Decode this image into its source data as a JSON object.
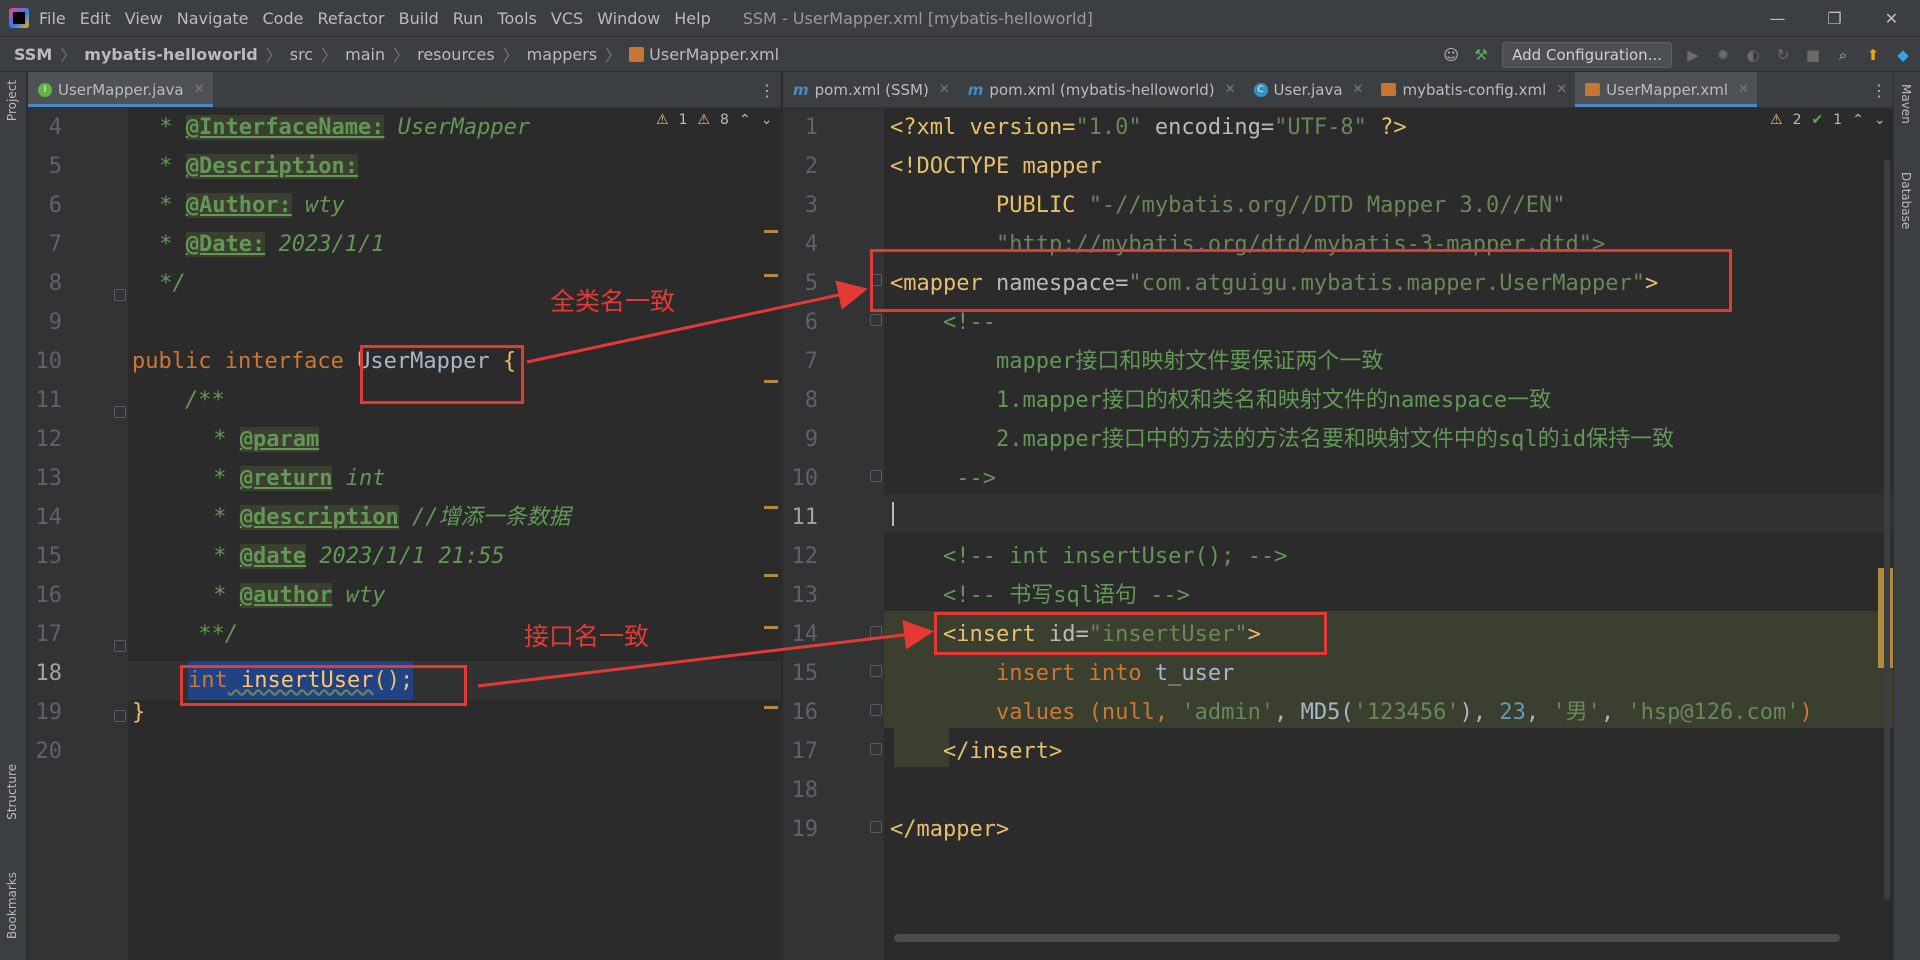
{
  "window": {
    "title": "SSM - UserMapper.xml [mybatis-helloworld]",
    "menu": [
      "File",
      "Edit",
      "View",
      "Navigate",
      "Code",
      "Refactor",
      "Build",
      "Run",
      "Tools",
      "VCS",
      "Window",
      "Help"
    ]
  },
  "breadcrumb": [
    "SSM",
    "mybatis-helloworld",
    "src",
    "main",
    "resources",
    "mappers",
    "UserMapper.xml"
  ],
  "toolbar": {
    "run_config_label": "Add Configuration..."
  },
  "side_left": {
    "project": "Project",
    "structure": "Structure",
    "bookmarks": "Bookmarks"
  },
  "side_right": {
    "maven": "Maven",
    "database": "Database"
  },
  "left_tabs": [
    {
      "label": "UserMapper.java"
    }
  ],
  "right_tabs": [
    {
      "label": "pom.xml (SSM)"
    },
    {
      "label": "pom.xml (mybatis-helloworld)"
    },
    {
      "label": "User.java"
    },
    {
      "label": "mybatis-config.xml"
    },
    {
      "label": "UserMapper.xml"
    }
  ],
  "left_inspections": {
    "a": "1",
    "b": "8"
  },
  "right_inspections": {
    "a": "2",
    "b": "1"
  },
  "left_editor": {
    "line_numbers": [
      "4",
      "5",
      "6",
      "7",
      "8",
      "9",
      "10",
      "11",
      "12",
      "13",
      "14",
      "15",
      "16",
      "17",
      "18",
      "19",
      "20"
    ],
    "current_line": "18",
    "lines": {
      "l4_tag": "@InterfaceName:",
      "l4_val": " UserMapper",
      "l5_tag": "@Description:",
      "l6_tag": "@Author:",
      "l6_val": " wty",
      "l7_tag": "@Date:",
      "l7_val": " 2023/1/1",
      "l8": " */",
      "l10_kw": "public interface ",
      "l10_name": "UserMapper",
      "l10_brace": " {",
      "l11": "    /**",
      "l12_tag": "@param",
      "l13_tag": "@return",
      "l13_val": " int",
      "l14_tag": "@description",
      "l14_val": " //增添一条数据",
      "l15_tag": "@date",
      "l15_val": " 2023/1/1 21:55",
      "l16_tag": "@author",
      "l16_val": " wty",
      "l17": "     **/",
      "l18_kw": "int",
      "l18_name": " insertUser",
      "l18_rest": "();",
      "l19": "}"
    }
  },
  "right_editor": {
    "line_numbers": [
      "1",
      "2",
      "3",
      "4",
      "5",
      "6",
      "7",
      "8",
      "9",
      "10",
      "11",
      "12",
      "13",
      "14",
      "15",
      "16",
      "17",
      "18",
      "19"
    ],
    "current_line": "11",
    "lines": {
      "l1_a": "<?xml version=",
      "l1_b": "\"1.0\"",
      "l1_c": " encoding=",
      "l1_d": "\"UTF-8\"",
      "l1_e": " ?>",
      "l2": "<!DOCTYPE mapper",
      "l3_a": "        PUBLIC ",
      "l3_b": "\"-//mybatis.org//DTD Mapper 3.0//EN\"",
      "l4": "        \"http://mybatis.org/dtd/mybatis-3-mapper.dtd\">",
      "l5_a": "<mapper",
      "l5_b": " namespace=",
      "l5_c": "\"com.atguigu.mybatis.mapper.UserMapper\"",
      "l5_d": ">",
      "l6": "    <!--",
      "l7": "        mapper接口和映射文件要保证两个一致",
      "l8": "        1.mapper接口的权和类名和映射文件的namespace一致",
      "l9": "        2.mapper接口中的方法的方法名要和映射文件中的sql的id保持一致",
      "l10": "     -->",
      "l12": "    <!-- int insertUser(); -->",
      "l13": "    <!-- 书写sql语句 -->",
      "l14_a": "    <insert",
      "l14_b": " id=",
      "l14_c": "\"insertUser\"",
      "l14_d": ">",
      "l15_a": "        insert into ",
      "l15_b": "t_user",
      "l16_a": "        values ",
      "l16_b": "(null, ",
      "l16_c": "'admin'",
      "l16_d": ", MD5(",
      "l16_e": "'123456'",
      "l16_f": "), ",
      "l16_g": "23",
      "l16_h": ", ",
      "l16_i": "'男'",
      "l16_j": ", ",
      "l16_k": "'hsp@126.com'",
      "l16_l": ")",
      "l17": "    </insert>",
      "l19": "</mapper>"
    }
  },
  "annotations": {
    "fqn_match": "全类名一致",
    "interface_match": "接口名一致"
  },
  "colors": {
    "annotation_red": "#e53935",
    "accent_blue": "#4a88c7",
    "bg": "#2b2b2b"
  }
}
